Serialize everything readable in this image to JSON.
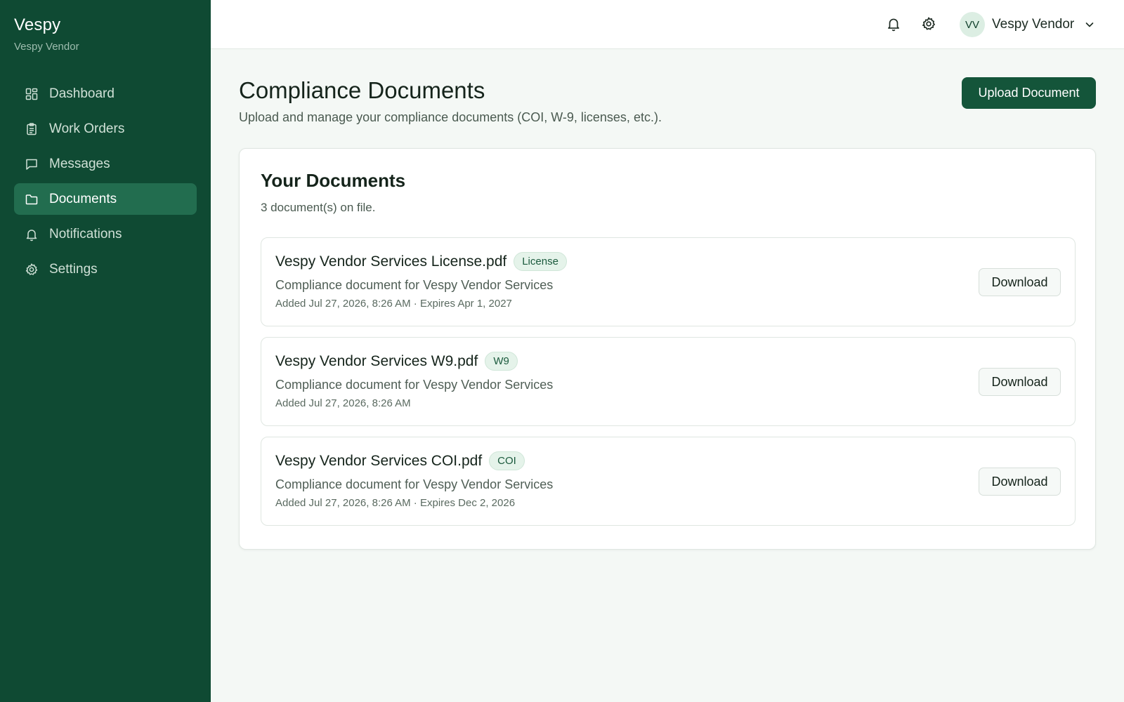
{
  "app": {
    "brand": "Vespy",
    "brand_sub": "Vespy Vendor"
  },
  "sidebar": {
    "items": [
      {
        "label": "Dashboard",
        "icon": "dashboard-icon"
      },
      {
        "label": "Work Orders",
        "icon": "clipboard-icon"
      },
      {
        "label": "Messages",
        "icon": "message-icon"
      },
      {
        "label": "Documents",
        "icon": "folder-icon",
        "active": true
      },
      {
        "label": "Notifications",
        "icon": "bell-icon"
      },
      {
        "label": "Settings",
        "icon": "gear-icon"
      }
    ]
  },
  "topbar": {
    "avatar_initials": "VV",
    "user_name": "Vespy Vendor"
  },
  "page": {
    "title": "Compliance Documents",
    "subtitle": "Upload and manage your compliance documents (COI, W-9, licenses, etc.).",
    "upload_label": "Upload Document"
  },
  "card": {
    "title": "Your Documents",
    "count_text": "3 document(s) on file."
  },
  "documents": [
    {
      "name": "Vespy Vendor Services License.pdf",
      "badge": "License",
      "description": "Compliance document for Vespy Vendor Services",
      "meta": "Added Jul 27, 2026, 8:26 AM · Expires Apr 1, 2027",
      "action": "Download"
    },
    {
      "name": "Vespy Vendor Services W9.pdf",
      "badge": "W9",
      "description": "Compliance document for Vespy Vendor Services",
      "meta": "Added Jul 27, 2026, 8:26 AM",
      "action": "Download"
    },
    {
      "name": "Vespy Vendor Services COI.pdf",
      "badge": "COI",
      "description": "Compliance document for Vespy Vendor Services",
      "meta": "Added Jul 27, 2026, 8:26 AM · Expires Dec 2, 2026",
      "action": "Download"
    }
  ],
  "colors": {
    "sidebar_bg": "#0f4a33",
    "active_item": "#226d4f",
    "primary_button": "#14553a",
    "badge_bg": "#e5f3ea"
  }
}
